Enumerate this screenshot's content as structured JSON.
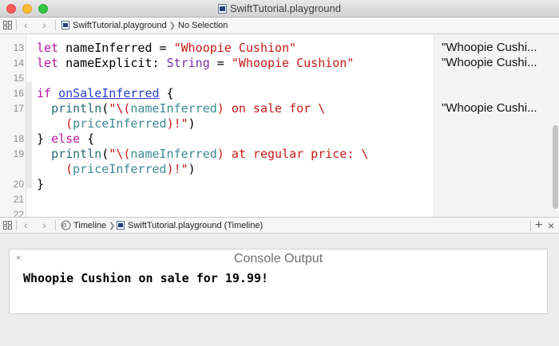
{
  "window": {
    "title": "SwiftTutorial.playground"
  },
  "jumpbar_top": {
    "file": "SwiftTutorial.playground",
    "selection": "No Selection"
  },
  "editor": {
    "lines": [
      {
        "num": "13",
        "tokens": [
          {
            "t": "let",
            "c": "kw"
          },
          {
            "t": " nameInferred = ",
            "c": ""
          },
          {
            "t": "\"Whoopie Cushion\"",
            "c": "str"
          }
        ]
      },
      {
        "num": "14",
        "tokens": [
          {
            "t": "let",
            "c": "kw"
          },
          {
            "t": " nameExplicit: ",
            "c": ""
          },
          {
            "t": "String",
            "c": "typ"
          },
          {
            "t": " = ",
            "c": ""
          },
          {
            "t": "\"Whoopie Cushion\"",
            "c": "str"
          }
        ]
      },
      {
        "num": "15",
        "tokens": []
      },
      {
        "num": "16",
        "tokens": [
          {
            "t": "if",
            "c": "kw"
          },
          {
            "t": " ",
            "c": ""
          },
          {
            "t": "onSaleInferred",
            "c": "link"
          },
          {
            "t": " {",
            "c": ""
          }
        ]
      },
      {
        "num": "17",
        "tokens": [
          {
            "t": "  ",
            "c": ""
          },
          {
            "t": "println",
            "c": "fn"
          },
          {
            "t": "(",
            "c": ""
          },
          {
            "t": "\"\\(",
            "c": "str"
          },
          {
            "t": "nameInferred",
            "c": "vr"
          },
          {
            "t": ") on sale for \\",
            "c": "str"
          }
        ]
      },
      {
        "num": "",
        "tokens": [
          {
            "t": "    (",
            "c": "str"
          },
          {
            "t": "priceInferred",
            "c": "vr"
          },
          {
            "t": ")!\"",
            "c": "str"
          },
          {
            "t": ")",
            "c": ""
          }
        ]
      },
      {
        "num": "18",
        "tokens": [
          {
            "t": "} ",
            "c": ""
          },
          {
            "t": "else",
            "c": "kw"
          },
          {
            "t": " {",
            "c": ""
          }
        ]
      },
      {
        "num": "19",
        "tokens": [
          {
            "t": "  ",
            "c": ""
          },
          {
            "t": "println",
            "c": "fn"
          },
          {
            "t": "(",
            "c": ""
          },
          {
            "t": "\"\\(",
            "c": "str"
          },
          {
            "t": "nameInferred",
            "c": "vr"
          },
          {
            "t": ") at regular price: \\",
            "c": "str"
          }
        ]
      },
      {
        "num": "",
        "tokens": [
          {
            "t": "    (",
            "c": "str"
          },
          {
            "t": "priceInferred",
            "c": "vr"
          },
          {
            "t": ")!\"",
            "c": "str"
          },
          {
            "t": ")",
            "c": ""
          }
        ]
      },
      {
        "num": "20",
        "tokens": [
          {
            "t": "}",
            "c": ""
          }
        ]
      },
      {
        "num": "21",
        "tokens": []
      },
      {
        "num": "22",
        "tokens": []
      }
    ],
    "results": [
      {
        "line_index": 0,
        "text": "\"Whoopie Cushi..."
      },
      {
        "line_index": 1,
        "text": "\"Whoopie Cushi..."
      },
      {
        "line_index": 4,
        "text": "\"Whoopie Cushi..."
      }
    ]
  },
  "jumpbar_bottom": {
    "timeline": "Timeline",
    "file": "SwiftTutorial.playground (Timeline)",
    "add": "+",
    "close": "×"
  },
  "console": {
    "title": "Console Output",
    "close": "×",
    "output": "Whoopie Cushion on sale for 19.99!"
  },
  "colors": {
    "keyword": "#b5179e",
    "string": "#c41a16",
    "type": "#7b31a8",
    "function": "#2a6a78",
    "variable": "#3c8a92",
    "link": "#2a3ec7"
  }
}
